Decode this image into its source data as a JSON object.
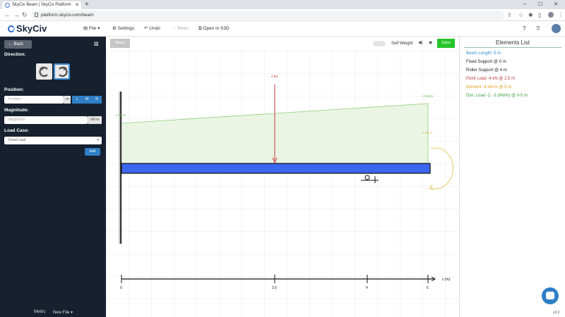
{
  "browser": {
    "tab_title": "SkyCiv Beam | SkyCiv Platform",
    "url": "platform.skyciv.com/beam"
  },
  "app": {
    "logo": "SkyCiv",
    "menu": {
      "file": "File",
      "settings": "Settings",
      "undo": "Undo",
      "redo": "Redo",
      "open_s3d": "Open in S3D"
    }
  },
  "left_panel": {
    "back": "Back",
    "direction_label": "Direction:",
    "position_label": "Position:",
    "position_placeholder": "Position",
    "position_unit": "m",
    "pos_buttons": [
      "L",
      "M",
      "R"
    ],
    "magnitude_label": "Magnitude:",
    "magnitude_placeholder": "Magnitude",
    "magnitude_unit": "kN·m",
    "load_case_label": "Load Case:",
    "load_case_value": "Dead Load",
    "add": "Add",
    "footer_metric": "Metric",
    "footer_newfile": "New File"
  },
  "canvas": {
    "model_btn": "Model",
    "self_weight": "Self Weight",
    "solve": "Solve",
    "labels": {
      "dist_left": "2 kN/m",
      "dist_right": "3 kN/m",
      "point": "4 kN",
      "moment": "4 kN·m"
    },
    "axis": {
      "ticks": [
        "0",
        "2.5",
        "4",
        "5"
      ],
      "label": "x (m)"
    }
  },
  "right_panel": {
    "title": "Elements List",
    "items": [
      {
        "text": "Beam Length: 5 m",
        "color": "#2f8fd0"
      },
      {
        "text": "Fixed Support @ 0 m",
        "color": "#222222"
      },
      {
        "text": "Roller Support @ 4 m",
        "color": "#222222"
      },
      {
        "text": "Point Load -4 kN @ 2.5 m",
        "color": "#c03a3a"
      },
      {
        "text": "Moment -4 kN-m @ 5 m",
        "color": "#e0a020"
      },
      {
        "text": "Dist. Load -2, -3 (kN/m) @ 0-5 m",
        "color": "#3a9a3a"
      }
    ],
    "version": "v3.2"
  }
}
